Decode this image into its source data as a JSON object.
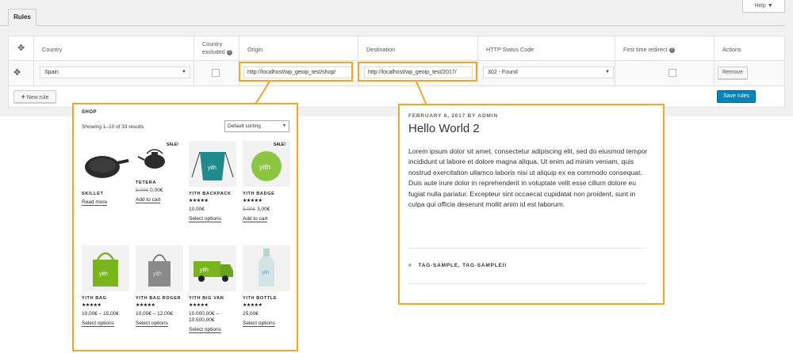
{
  "admin": {
    "tab_label": "Rules",
    "help_label": "Help ▼",
    "columns": {
      "country": "Country",
      "country_excluded_1": "Country",
      "country_excluded_2": "excluded",
      "origin": "Origin",
      "destination": "Destination",
      "status_code": "HTTP Status Code",
      "first_time": "First time redirect",
      "actions": "Actions",
      "help_glyph": "?"
    },
    "row": {
      "country": "Spain",
      "origin": "http://localhost/wp_geoip_test/shop/",
      "destination": "http://localhost/wp_geoip_test/2017/",
      "status": "302 - Found",
      "remove_label": "Remove"
    },
    "new_rule_label": "New rule",
    "save_label": "Save rules",
    "accent_color": "#f5a623",
    "primary_color": "#0085ba"
  },
  "shop": {
    "title": "SHOP",
    "count": "Showing 1–10 of 33 results",
    "sort": "Default sorting",
    "sale_label": "SALE!",
    "stars": "★★★★★",
    "products": [
      {
        "name": "SKILLET",
        "link": "Read more"
      },
      {
        "name": "TETERA",
        "old_price": "5,00€",
        "price": "0,00€",
        "link": "Add to cart"
      },
      {
        "name": "YITH BACKPACK",
        "price": "10,00€",
        "link": "Select options"
      },
      {
        "name": "YITH BADGE",
        "old_price": "5,00€",
        "price": "3,00€",
        "link": "Add to cart"
      },
      {
        "name": "YITH BAG",
        "price": "10,00€ – 15,00€",
        "link": "Select options"
      },
      {
        "name": "YITH BAG ROGER",
        "price": "10,00€ – 12,00€",
        "link": "Select options"
      },
      {
        "name": "YITH BIG VAN",
        "price_line1": "10.000,00€ –",
        "price_line2": "10.500,00€",
        "link": "Select options"
      },
      {
        "name": "YITH BOTTLE",
        "price": "25,00€",
        "link": "Select options"
      }
    ],
    "brand_text": "yith"
  },
  "post": {
    "meta": "FEBRUARY 6, 2017 BY ADMIN",
    "title": "Hello World 2",
    "body": "Lorem ipsum dolor sit amet, consectetur adipiscing elit, sed do eiusmod tempor incididunt ut labore et dolore magna aliqua. Ut enim ad minim veniam, quis nostrud exercitation ullamco laboris nisi ut aliquip ex ea commodo consequat. Duis aute irure dolor in reprehenderit in voluptate velit esse cillum dolore eu fugiat nulla pariatur. Excepteur sint occaecat cupidatat non proident, sunt in culpa qui officia deserunt mollit anim id est laborum.",
    "hash": "#",
    "tags": "TAG-SAMPLE, TAG-SAMPLEII"
  }
}
